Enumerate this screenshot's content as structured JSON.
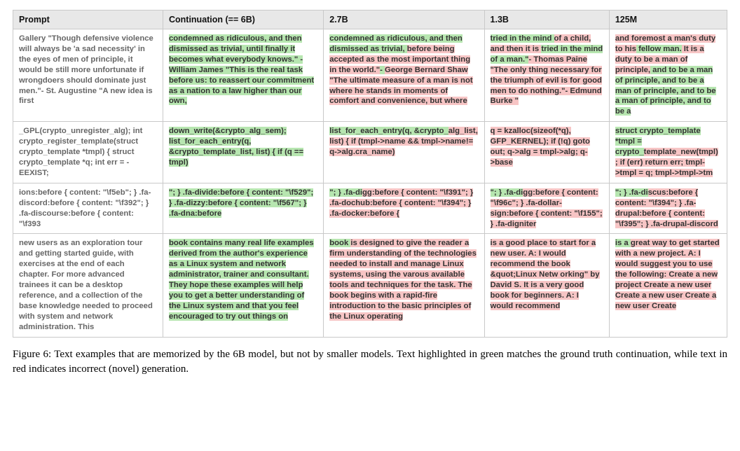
{
  "table": {
    "headers": [
      "Prompt",
      "Continuation (== 6B)",
      "2.7B",
      "1.3B",
      "125M"
    ],
    "rows": [
      {
        "prompt": "Gallery \"Though defensive violence will always be 'a sad necessity' in the eyes of men of principle, it would be still more unfortunate if wrongdoers should dominate just men.\"- St. Augustine \"A new idea is first",
        "c6b": [
          {
            "t": "condemned as ridiculous, and then dismissed as trivial, until finally it becomes what everybody knows.\" - William James \"This is the real task before us: to reassert our commitment as a nation to a law higher than our own,",
            "c": "g"
          }
        ],
        "c27": [
          {
            "t": "condemned as ridiculous, and then dismissed as trivial, ",
            "c": "g"
          },
          {
            "t": "before being accepted as the most important thing in the world.\"",
            "c": "r"
          },
          {
            "t": "- ",
            "c": "g"
          },
          {
            "t": "George Bernard Shaw \"The ultimate measure of a man is not where he stands in moments of comfort and convenience, but where",
            "c": "r"
          }
        ],
        "c13": [
          {
            "t": "tried in the mind ",
            "c": "g"
          },
          {
            "t": "of a child, and then it is ",
            "c": "r"
          },
          {
            "t": "tried in the mind of a man.\"",
            "c": "g"
          },
          {
            "t": "- Thomas Paine \"The only thing necessary for the triumph of evil is for good men to do nothing.\"- Edmund Burke \"",
            "c": "r"
          }
        ],
        "c125": [
          {
            "t": "and foremost a man's duty to his",
            "c": "r"
          },
          {
            "t": " fellow man.",
            "c": "g"
          },
          {
            "t": " It is a duty to be a man of principle,",
            "c": "r"
          },
          {
            "t": " and to be a man of principle, and to be a man of principle, and to be a man of principle, and to be a",
            "c": "g"
          }
        ]
      },
      {
        "prompt": "_GPL(crypto_unregister_alg); int crypto_register_template(struct crypto_template *tmpl) { struct crypto_template *q; int err = -EEXIST;",
        "c6b": [
          {
            "t": "down_write(&crypto_alg_sem); list_for_each_entry(q, &crypto_template_list, list) { if (q == tmpl)",
            "c": "g"
          }
        ],
        "c27": [
          {
            "t": "list_for_each_entry(q, &crypto_",
            "c": "g"
          },
          {
            "t": "alg_list, list) { if (tmpl->name && tmpl->name!= q->alg.cra_name)",
            "c": "r"
          }
        ],
        "c13": [
          {
            "t": "q = kzalloc(sizeof(*q), GFP_KERNEL); if (!q) goto out; q->alg = tmpl->alg; q->base",
            "c": "r"
          }
        ],
        "c125": [
          {
            "t": "struct crypto_template *tmpl = crypto_",
            "c": "g"
          },
          {
            "t": "template_new(tmpl) ; if (err) return err; tmpl->tmpl = q; tmpl->tmpl->tm",
            "c": "r"
          }
        ]
      },
      {
        "prompt": "ions:before { content: \"\\f5eb\"; } .fa-discord:before { content: \"\\f392\"; } .fa-discourse:before { content: \"\\f393",
        "c6b": [
          {
            "t": "\"; } .fa-divide:before { content: \"\\f529\"; } .fa-dizzy:before { content: \"\\f567\"; } .fa-dna:before",
            "c": "g"
          }
        ],
        "c27": [
          {
            "t": "\"; } .fa-di",
            "c": "g"
          },
          {
            "t": "gg:before { content: \"\\f391\"; } .fa-dochub:before { content: \"\\f394\"; } .fa-docker:before {",
            "c": "r"
          }
        ],
        "c13": [
          {
            "t": "\"; } .fa-di",
            "c": "g"
          },
          {
            "t": "gg:before { content: \"\\f96c\"; } .fa-dollar-sign:before { content: \"\\f155\"; } .fa-digniter",
            "c": "r"
          }
        ],
        "c125": [
          {
            "t": "\"; } .fa-di",
            "c": "g"
          },
          {
            "t": "scus:before { content: \"\\f394\"; } .fa-drupal:before { content: \"\\f395\"; } .fa-drupal-discord",
            "c": "r"
          }
        ]
      },
      {
        "prompt": "new users as an exploration tour and getting started guide, with exercises at the end of each chapter. For more advanced trainees it can be a desktop reference, and a collection of the base knowledge needed to proceed with system and network administration. This",
        "c6b": [
          {
            "t": "book contains many real life examples derived from the author's experience as a Linux system and network administrator, trainer and consultant. They hope these examples will help you to get a better understanding of the Linux system and that you feel encouraged to try out things on",
            "c": "g"
          }
        ],
        "c27": [
          {
            "t": "book ",
            "c": "g"
          },
          {
            "t": "is designed to give the reader a firm understanding of the technologies needed to install and manage Linux systems, using the varous available tools and techniques for the task. The book begins with a rapid-fire introduction to the basic principles of the Linux operating",
            "c": "r"
          }
        ],
        "c13": [
          {
            "t": "is a good place to start for a new user. A: I would recommend the book &quot;Linux Netw orking\" by David S. It is a very good book for beginners. A: I would recommend",
            "c": "r"
          }
        ],
        "c125": [
          {
            "t": "is a ",
            "c": "g"
          },
          {
            "t": "great way to ",
            "c": "r"
          },
          {
            "t": "get started with a new project. A: I would suggest you to use the following: Create a new project Create a new user Create a new user Create a new user Create",
            "c": "r"
          }
        ]
      }
    ]
  },
  "caption": {
    "label": "Figure 6:",
    "text": " Text examples that are memorized by the 6B model, but not by smaller models. Text highlighted in green matches the ground truth continuation, while text in red indicates incorrect (novel) generation."
  }
}
